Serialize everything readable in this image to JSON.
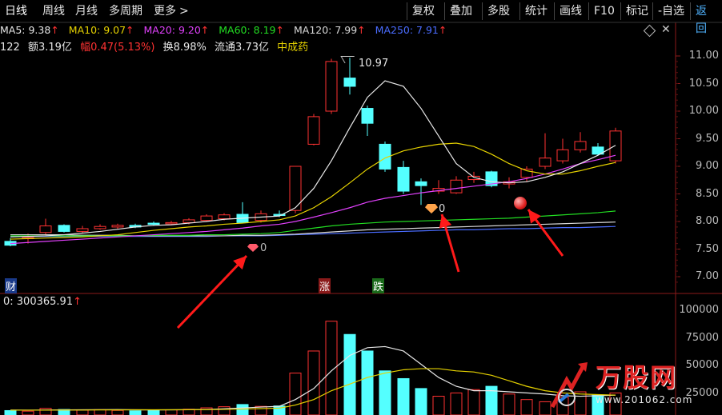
{
  "topbar": {
    "tabs": [
      {
        "label": "日线",
        "active": true
      },
      {
        "label": "周线",
        "active": false
      },
      {
        "label": "月线",
        "active": false
      },
      {
        "label": "多周期",
        "active": false
      },
      {
        "label": "更多",
        "active": false
      }
    ],
    "more_arrow": ">",
    "controls": [
      "复权",
      "叠加",
      "多股",
      "统计",
      "画线",
      "F10",
      "标记",
      "-自选",
      "返回"
    ]
  },
  "ma": [
    {
      "label": "MA5: 9.38",
      "color": "#e8e8e8"
    },
    {
      "label": "MA10: 9.07",
      "color": "#e6d200"
    },
    {
      "label": "MA20: 9.20",
      "color": "#e040fb"
    },
    {
      "label": "MA60: 8.19",
      "color": "#22dd22"
    },
    {
      "label": "MA120: 7.99",
      "color": "#d8d8d8"
    },
    {
      "label": "MA250: 7.91",
      "color": "#4a6cff"
    }
  ],
  "info": {
    "prefix": "122",
    "amount": "额3.19亿",
    "amp": "幅0.47(5.13%)",
    "turnover": "换8.98%",
    "float": "流通3.73亿",
    "sector": "中成药"
  },
  "price_axis": [
    "11.00",
    "10.50",
    "10.00",
    "9.50",
    "9.00",
    "8.50",
    "8.00",
    "7.50",
    "7.00"
  ],
  "volume_axis": [
    "100000",
    "75000",
    "50000",
    "25000"
  ],
  "markers": {
    "high_label": "10.97",
    "signal_a": "0",
    "signal_b": "0",
    "cai": "财",
    "zhang": "涨",
    "die": "跌"
  },
  "volume_readout": "0: 300365.91",
  "watermark": {
    "brand": "万股网",
    "url": "www.201062.com"
  },
  "colors": {
    "up": "#ff3232",
    "down": "#54ffff",
    "arrow": "#ff1a1a"
  }
}
